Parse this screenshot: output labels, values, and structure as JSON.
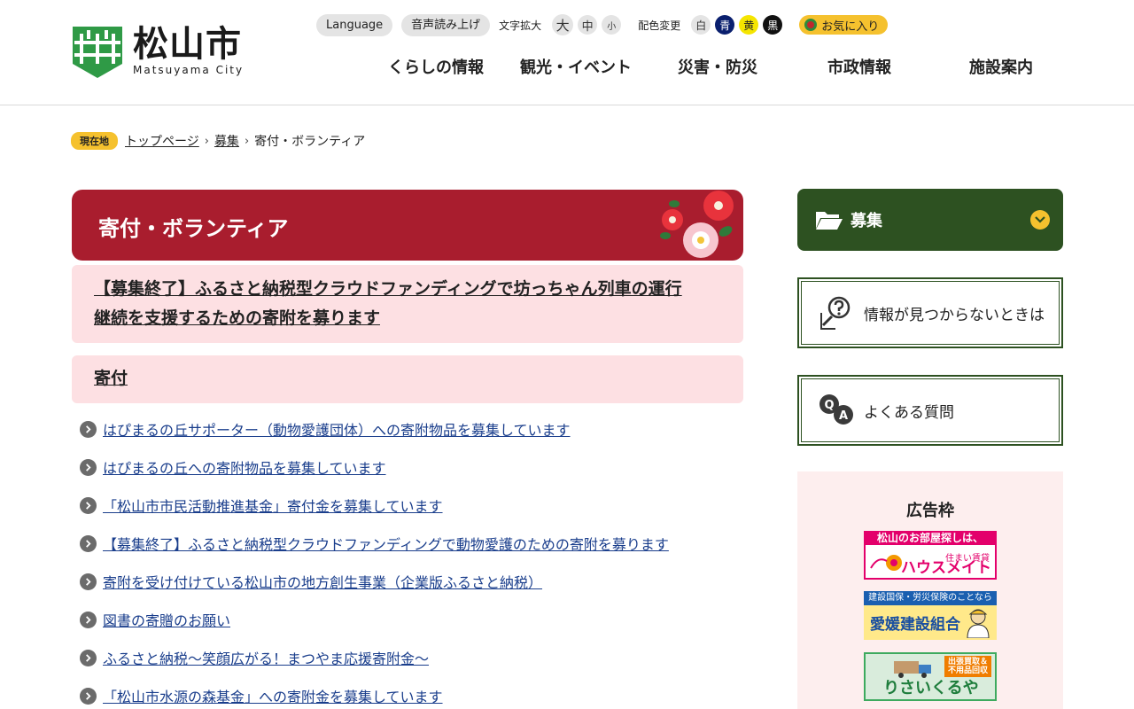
{
  "header": {
    "logo_jp": "松山市",
    "logo_en": "Matsuyama City",
    "language_label": "Language",
    "read_aloud_label": "音声読み上げ",
    "text_size_label": "文字拡大",
    "text_size_options": [
      "大",
      "中",
      "小"
    ],
    "color_label": "配色変更",
    "color_options": [
      "白",
      "青",
      "黄",
      "黒"
    ],
    "favorites_label": "お気に入り"
  },
  "global_nav": [
    "くらしの情報",
    "観光・イベント",
    "災害・防災",
    "市政情報",
    "施設案内"
  ],
  "breadcrumb": {
    "badge": "現在地",
    "items": [
      "トップページ",
      "募集",
      "寄付・ボランティア"
    ]
  },
  "main": {
    "page_title": "寄付・ボランティア",
    "highlight_link_line1": "【募集終了】ふるさと納税型クラウドファンディングで坊っちゃん列車の運行",
    "highlight_link_line2": "継続を支援するための寄附を募ります",
    "section_heading": "寄付",
    "links": [
      "はぴまるの丘サポーター（動物愛護団体）への寄附物品を募集しています",
      "はぴまるの丘への寄附物品を募集しています",
      "「松山市市民活動推進基金」寄付金を募集しています",
      "【募集終了】ふるさと納税型クラウドファンディングで動物愛護のための寄附を募ります",
      "寄附を受け付けている松山市の地方創生事業（企業版ふるさと納税）",
      "図書の寄贈のお願い",
      "ふるさと納税～笑顔広がる！まつやま応援寄附金～",
      "「松山市水源の森基金」への寄附金を募集しています"
    ]
  },
  "sidebar": {
    "menu_label": "募集",
    "help_label": "情報が見つからないときは",
    "faq_label": "よくある質問",
    "ad_title": "広告枠",
    "ad1": {
      "top": "松山のお部屋探しは、",
      "sub": "住まい賃貸",
      "name": "ハウスメイト"
    },
    "ad2": {
      "top": "建設国保・労災保険のことなら",
      "name": "愛媛建設組合"
    },
    "ad3": {
      "tag_line1": "出張買取＆",
      "tag_line2": "不用品回収",
      "name": "りさいくるや"
    }
  },
  "colors": {
    "title_band": "#a91d2e",
    "side_menu": "#2d5121",
    "accent_yellow": "#f5c12e",
    "pink_block": "#fde0e3",
    "link": "#1a3e8c"
  }
}
